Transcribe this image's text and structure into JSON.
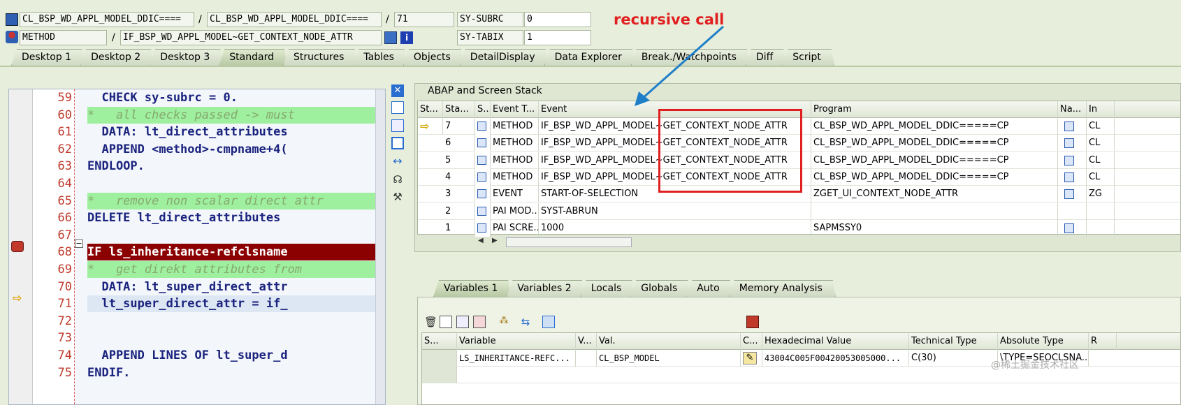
{
  "header": {
    "field1": "CL_BSP_WD_APPL_MODEL_DDIC====",
    "field2": "CL_BSP_WD_APPL_MODEL_DDIC====",
    "field3": "71",
    "subrc_label": "SY-SUBRC",
    "subrc_value": "0",
    "type_field": "METHOD",
    "method_field": "IF_BSP_WD_APPL_MODEL~GET_CONTEXT_NODE_ATTR",
    "tabix_label": "SY-TABIX",
    "tabix_value": "1",
    "slash": "/"
  },
  "main_tabs": [
    "Desktop 1",
    "Desktop 2",
    "Desktop 3",
    "Standard",
    "Structures",
    "Tables",
    "Objects",
    "DetailDisplay",
    "Data Explorer",
    "Break./Watchpoints",
    "Diff",
    "Script"
  ],
  "code_lines": [
    {
      "no": "59",
      "text": "  CHECK sy-subrc = 0.",
      "comment": false
    },
    {
      "no": "60",
      "text": "*   all checks passed -> must",
      "comment": true
    },
    {
      "no": "61",
      "text": "  DATA: lt_direct_attributes",
      "comment": false
    },
    {
      "no": "62",
      "text": "  APPEND <method>-cmpname+4(",
      "comment": false
    },
    {
      "no": "63",
      "text": "ENDLOOP.",
      "comment": false
    },
    {
      "no": "64",
      "text": "",
      "comment": false
    },
    {
      "no": "65",
      "text": "*   remove non scalar direct attr",
      "comment": true
    },
    {
      "no": "66",
      "text": "DELETE lt_direct_attributes",
      "comment": false
    },
    {
      "no": "67",
      "text": "",
      "comment": false
    },
    {
      "no": "68",
      "text": "IF ls_inheritance-refclsname",
      "comment": false
    },
    {
      "no": "69",
      "text": "*   get direkt attributes from",
      "comment": true
    },
    {
      "no": "70",
      "text": "  DATA: lt_super_direct_attr",
      "comment": false
    },
    {
      "no": "71",
      "text": "  lt_super_direct_attr = if_",
      "comment": false
    },
    {
      "no": "72",
      "text": "",
      "comment": false
    },
    {
      "no": "73",
      "text": "",
      "comment": false
    },
    {
      "no": "74",
      "text": "  APPEND LINES OF lt_super_d",
      "comment": false
    },
    {
      "no": "75",
      "text": "ENDIF.",
      "comment": false
    }
  ],
  "stack": {
    "title": "ABAP and Screen Stack",
    "columns": [
      "St...",
      "Sta...",
      "S...",
      "Event T...",
      "Event",
      "Program",
      "Na...",
      "In"
    ],
    "rows": [
      {
        "level": "7",
        "type": "METHOD",
        "event": "IF_BSP_WD_APPL_MODEL~GET_CONTEXT_NODE_ATTR",
        "program": "CL_BSP_WD_APPL_MODEL_DDIC=====CP",
        "inc": "CL",
        "current": true
      },
      {
        "level": "6",
        "type": "METHOD",
        "event": "IF_BSP_WD_APPL_MODEL~GET_CONTEXT_NODE_ATTR",
        "program": "CL_BSP_WD_APPL_MODEL_DDIC=====CP",
        "inc": "CL",
        "current": false
      },
      {
        "level": "5",
        "type": "METHOD",
        "event": "IF_BSP_WD_APPL_MODEL~GET_CONTEXT_NODE_ATTR",
        "program": "CL_BSP_WD_APPL_MODEL_DDIC=====CP",
        "inc": "CL",
        "current": false
      },
      {
        "level": "4",
        "type": "METHOD",
        "event": "IF_BSP_WD_APPL_MODEL~GET_CONTEXT_NODE_ATTR",
        "program": "CL_BSP_WD_APPL_MODEL_DDIC=====CP",
        "inc": "CL",
        "current": false
      },
      {
        "level": "3",
        "type": "EVENT",
        "event": "START-OF-SELECTION",
        "program": "ZGET_UI_CONTEXT_NODE_ATTR",
        "inc": "ZG",
        "current": false
      },
      {
        "level": "2",
        "type": "PAI MOD...",
        "event": "SYST-ABRUN",
        "program": "",
        "inc": "",
        "current": false
      },
      {
        "level": "1",
        "type": "PAI SCRE...",
        "event": "1000",
        "program": "SAPMSSY0",
        "inc": "",
        "current": false
      }
    ]
  },
  "annotation": "recursive call",
  "var_tabs": [
    "Variables 1",
    "Variables 2",
    "Locals",
    "Globals",
    "Auto",
    "Memory Analysis"
  ],
  "vars": {
    "columns": [
      "S...",
      "Variable",
      "V...",
      "Val.",
      "C...",
      "Hexadecimal Value",
      "Technical Type",
      "Absolute Type",
      "R"
    ],
    "row": {
      "variable": "LS_INHERITANCE-REFC...",
      "value": "CL_BSP_MODEL",
      "hex": "43004C005F00420053005000...",
      "tech": "C(30)",
      "abs": "\\TYPE=SEOCLSNA..."
    }
  },
  "watermark": "@稀土掘金技术社区",
  "colors": {
    "annotation": "#e02020",
    "arrow": "#1e7fc8",
    "highlight_box": "#e02020",
    "breakpoint_line": "#8b0000",
    "comment_bg": "#9ef09e"
  }
}
